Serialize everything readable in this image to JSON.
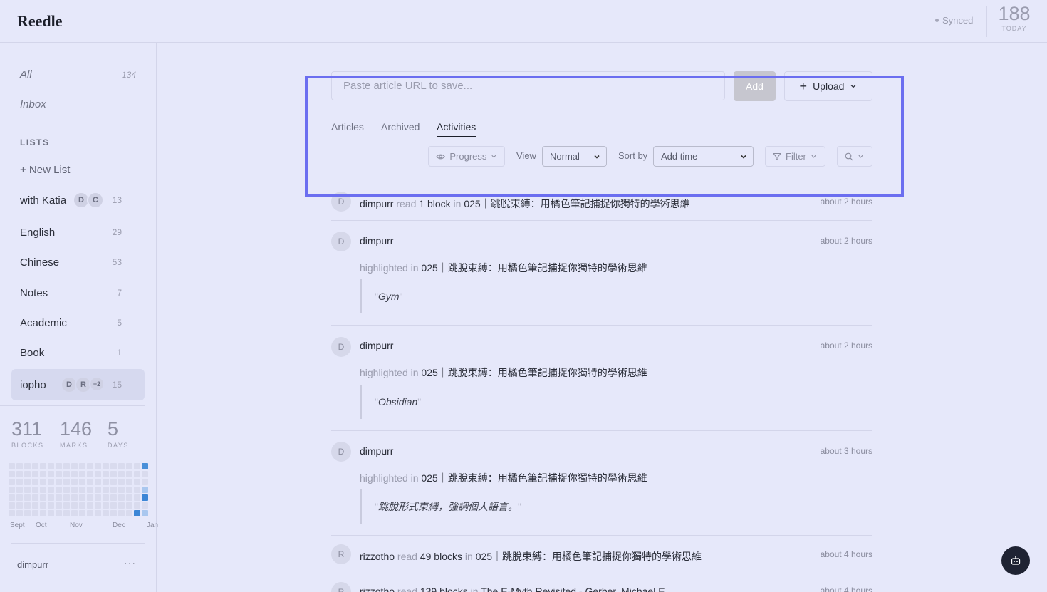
{
  "app": {
    "title": "Reedle"
  },
  "header": {
    "sync_status": "Synced",
    "today_count": "188",
    "today_label": "TODAY"
  },
  "sidebar": {
    "all": {
      "label": "All",
      "count": "134"
    },
    "inbox": {
      "label": "Inbox"
    },
    "lists_header": "LISTS",
    "new_list": "+ New List",
    "lists": [
      {
        "name": "with Katia",
        "count": "13",
        "avatars": [
          "D",
          "C"
        ]
      },
      {
        "name": "English",
        "count": "29"
      },
      {
        "name": "Chinese",
        "count": "53"
      },
      {
        "name": "Notes",
        "count": "7"
      },
      {
        "name": "Academic",
        "count": "5"
      },
      {
        "name": "Book",
        "count": "1"
      },
      {
        "name": "iopho",
        "count": "15",
        "avatars": [
          "D",
          "R",
          "+2"
        ],
        "active": true
      }
    ],
    "stats": [
      {
        "value": "311",
        "label": "BLOCKS"
      },
      {
        "value": "146",
        "label": "MARKS"
      },
      {
        "value": "5",
        "label": "DAYS"
      }
    ],
    "months": [
      "Sept",
      "Oct",
      "Nov",
      "Dec",
      "Jan"
    ],
    "user": "dimpurr",
    "user_menu": "···"
  },
  "main": {
    "url_placeholder": "Paste article URL to save...",
    "add_label": "Add",
    "upload_label": "Upload",
    "tabs": [
      "Articles",
      "Archived",
      "Activities"
    ],
    "active_tab": "Activities",
    "progress_label": "Progress",
    "view_label": "View",
    "view_value": "Normal",
    "sort_label": "Sort by",
    "sort_value": "Add time",
    "filter_label": "Filter"
  },
  "feed": [
    {
      "avatar": "D",
      "user": "dimpurr",
      "action": "read",
      "detail": "1 block",
      "prep": "in",
      "article": "025｜跳脫束縛：用橘色筆記捕捉你獨特的學術思維",
      "time": "about 2 hours"
    },
    {
      "avatar": "D",
      "user": "dimpurr",
      "action": "highlighted in",
      "article": "025｜跳脫束縛：用橘色筆記捕捉你獨特的學術思維",
      "quote": "Gym",
      "time": "about 2 hours"
    },
    {
      "avatar": "D",
      "user": "dimpurr",
      "action": "highlighted in",
      "article": "025｜跳脫束縛：用橘色筆記捕捉你獨特的學術思維",
      "quote": "Obsidian",
      "time": "about 2 hours"
    },
    {
      "avatar": "D",
      "user": "dimpurr",
      "action": "highlighted in",
      "article": "025｜跳脫束縛：用橘色筆記捕捉你獨特的學術思維",
      "quote": "跳脫形式束縛，強調個人語言。",
      "time": "about 3 hours"
    },
    {
      "avatar": "R",
      "user": "rizzotho",
      "action": "read",
      "detail": "49 blocks",
      "prep": "in",
      "article": "025｜跳脫束縛：用橘色筆記捕捉你獨特的學術思維",
      "time": "about 4 hours"
    },
    {
      "avatar": "R",
      "user": "rizzotho",
      "action": "read",
      "detail": "139 blocks",
      "prep": "in",
      "article": "The E-Myth Revisited - Gerber, Michael E.",
      "time": "about 4 hours"
    }
  ],
  "icons": {
    "eye": "eye-icon",
    "filter": "filter-icon",
    "search": "search-icon",
    "bot": "bot-icon",
    "plus": "plus-icon",
    "chevron": "chevron-down-icon"
  },
  "colors": {
    "background": "#e6e8fa",
    "accent_blue": "#4a90d9",
    "highlight_frame": "#6b6ef0",
    "bot_button": "#1f2333"
  }
}
